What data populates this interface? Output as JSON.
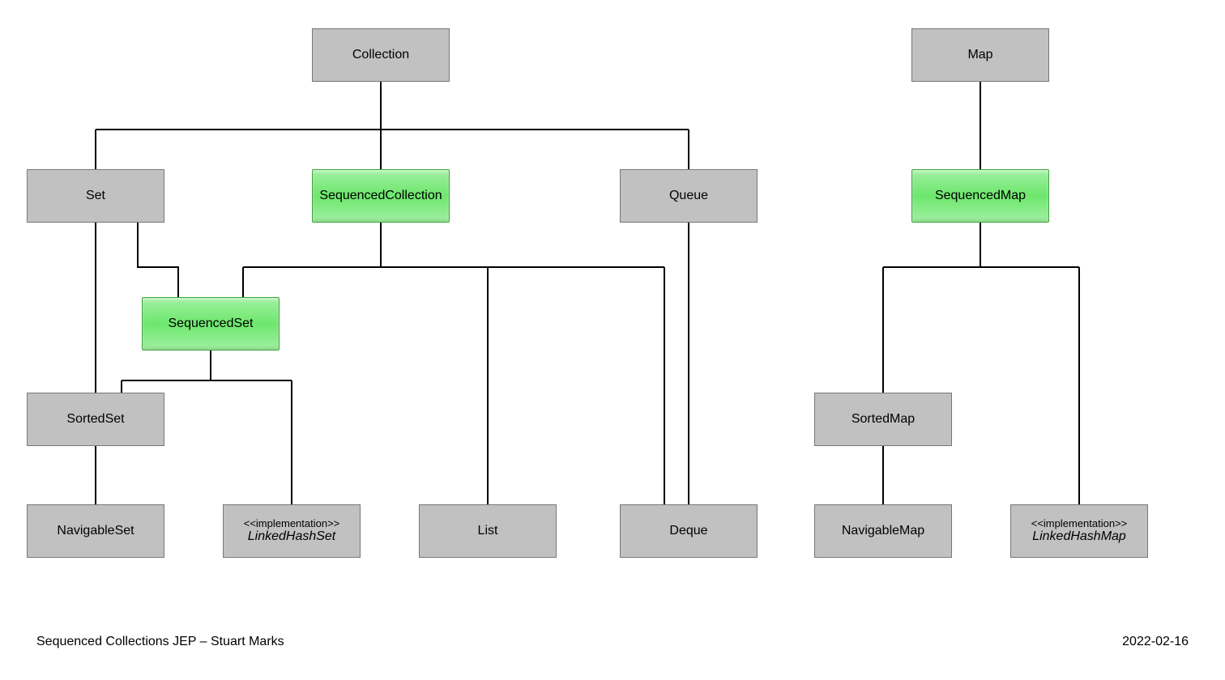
{
  "nodes": {
    "collection": {
      "label": "Collection"
    },
    "map": {
      "label": "Map"
    },
    "set": {
      "label": "Set"
    },
    "sequencedCollection": {
      "label": "SequencedCollection"
    },
    "queue": {
      "label": "Queue"
    },
    "sequencedMap": {
      "label": "SequencedMap"
    },
    "sequencedSet": {
      "label": "SequencedSet"
    },
    "sortedSet": {
      "label": "SortedSet"
    },
    "sortedMap": {
      "label": "SortedMap"
    },
    "navigableSet": {
      "label": "NavigableSet"
    },
    "linkedHashSet": {
      "stereo": "<<implementation>>",
      "label": "LinkedHashSet"
    },
    "list": {
      "label": "List"
    },
    "deque": {
      "label": "Deque"
    },
    "navigableMap": {
      "label": "NavigableMap"
    },
    "linkedHashMap": {
      "stereo": "<<implementation>>",
      "label": "LinkedHashMap"
    }
  },
  "footer": {
    "left": "Sequenced Collections JEP – Stuart Marks",
    "right": "2022-02-16"
  },
  "colors": {
    "highlight": "#6de76d",
    "box": "#c1c1c1"
  }
}
